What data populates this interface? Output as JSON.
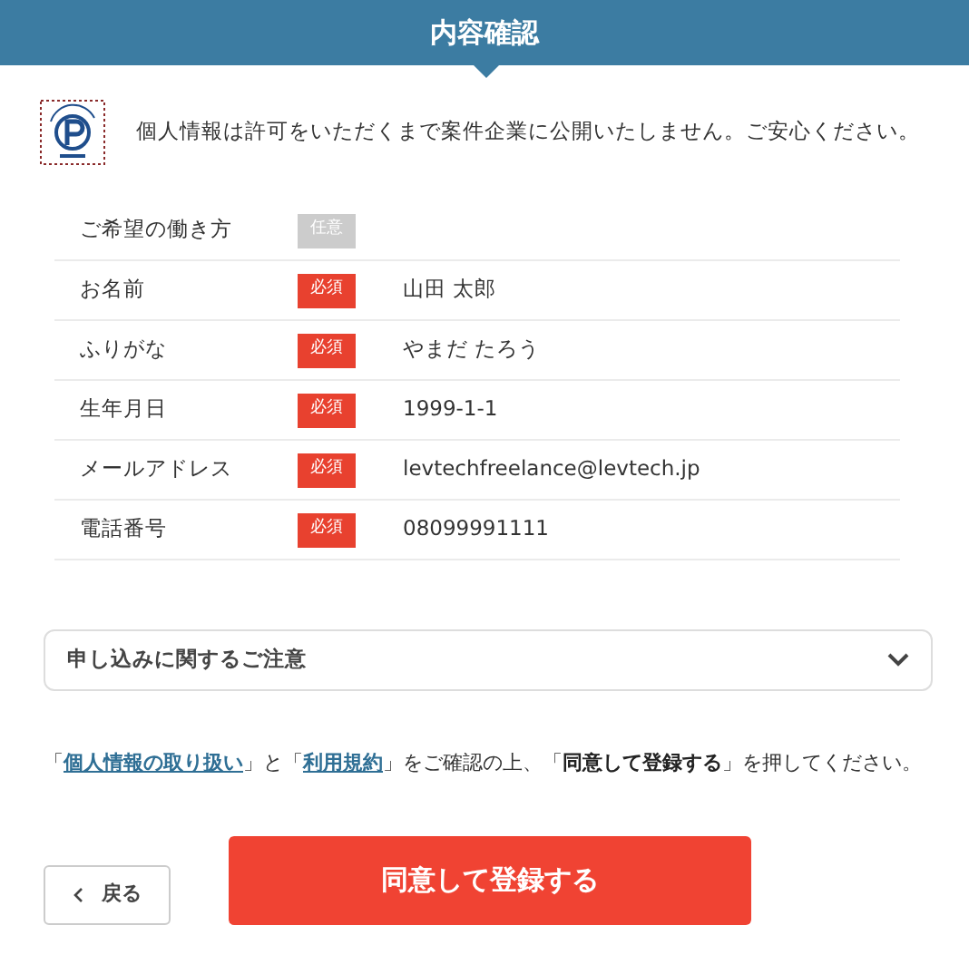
{
  "header": {
    "title": "内容確認"
  },
  "notice": "個人情報は許可をいただくまで案件企業に公開いたしません。ご安心ください。",
  "rows": [
    {
      "label": "ご希望の働き方",
      "badge": {
        "kind": "optional",
        "text": "任意"
      }
    },
    {
      "label": "お名前",
      "badge": {
        "kind": "required",
        "text": "必須"
      },
      "value": "山田 太郎"
    },
    {
      "label": "ふりがな",
      "badge": {
        "kind": "required",
        "text": "必須"
      },
      "value": "やまだ たろう"
    },
    {
      "label": "生年月日",
      "badge": {
        "kind": "required",
        "text": "必須"
      },
      "value": "1999-1-1"
    },
    {
      "label": "メールアドレス",
      "badge": {
        "kind": "required",
        "text": "必須"
      },
      "value": "levtechfreelance@levtech.jp"
    },
    {
      "label": "電話番号",
      "badge": {
        "kind": "required",
        "text": "必須"
      },
      "value": "08099991111"
    }
  ],
  "accordion": {
    "title": "申し込みに関するご注意",
    "expanded": false
  },
  "consent": [
    {
      "kind": "text",
      "text": "「"
    },
    {
      "kind": "link",
      "text": "個人情報の取り扱い"
    },
    {
      "kind": "text",
      "text": "」と「"
    },
    {
      "kind": "link",
      "text": "利用規約"
    },
    {
      "kind": "text",
      "text": "」をご確認の上、「"
    },
    {
      "kind": "bold",
      "text": "同意して登録する"
    },
    {
      "kind": "text",
      "text": "」を押してください。"
    }
  ],
  "buttons": {
    "back": "戻る",
    "submit": "同意して登録する"
  }
}
